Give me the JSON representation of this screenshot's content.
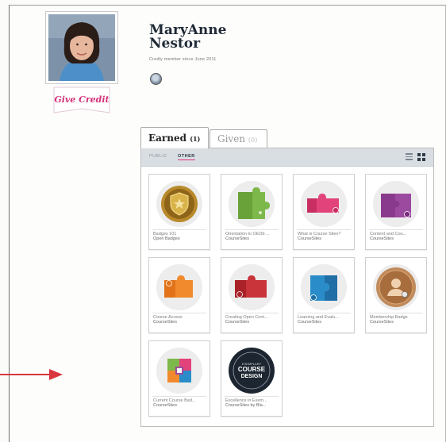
{
  "profile": {
    "name": "MaryAnne Nestor",
    "member_since": "Credly member since June 2011",
    "give_credit": "Give Credit",
    "avatar_icon": "user-photo",
    "small_badge_icon": "badge-thumbnail"
  },
  "tabs": [
    {
      "label": "Earned",
      "count": "(1)",
      "active": true
    },
    {
      "label": "Given",
      "count": "(0)",
      "active": false
    }
  ],
  "filters": {
    "public": "PUBLIC",
    "other": "OTHER",
    "active": "OTHER"
  },
  "view_toggles": {
    "list_icon": "list-view-icon",
    "grid_icon": "grid-view-icon",
    "active": "grid"
  },
  "badges": [
    {
      "title": "Badges 101",
      "issuer": "Open Badges",
      "icon": "gold-shield-badge"
    },
    {
      "title": "Orientation to OEDb ...",
      "issuer": "CourseSites",
      "icon": "green-puzzle-badge"
    },
    {
      "title": "What is Course Sites?",
      "issuer": "CourseSites",
      "icon": "pink-puzzle-badge"
    },
    {
      "title": "Content and Cou...",
      "issuer": "CourseSites",
      "icon": "purple-puzzle-badge"
    },
    {
      "title": "Course Access",
      "issuer": "CourseSites",
      "icon": "orange-puzzle-badge"
    },
    {
      "title": "Creating Open Cont...",
      "issuer": "CourseSites",
      "icon": "red-puzzle-badge"
    },
    {
      "title": "Learning and Evalu...",
      "issuer": "CourseSites",
      "icon": "blue-puzzle-badge"
    },
    {
      "title": "Membership Badge",
      "issuer": "CourseSites",
      "icon": "bronze-seal-badge"
    },
    {
      "title": "Current Course Bad...",
      "issuer": "CourseSites",
      "icon": "multicolor-puzzle-badge"
    },
    {
      "title": "Excellence in Exem...",
      "issuer": "CourseSites by Bla...",
      "icon": "course-design-badge",
      "icon_text": [
        "EXEMPLARY",
        "COURSE",
        "DESIGN"
      ]
    }
  ],
  "colors": {
    "accent": "#e0307a",
    "toolbar": "#d9dee3",
    "arrow": "#d9363e"
  }
}
